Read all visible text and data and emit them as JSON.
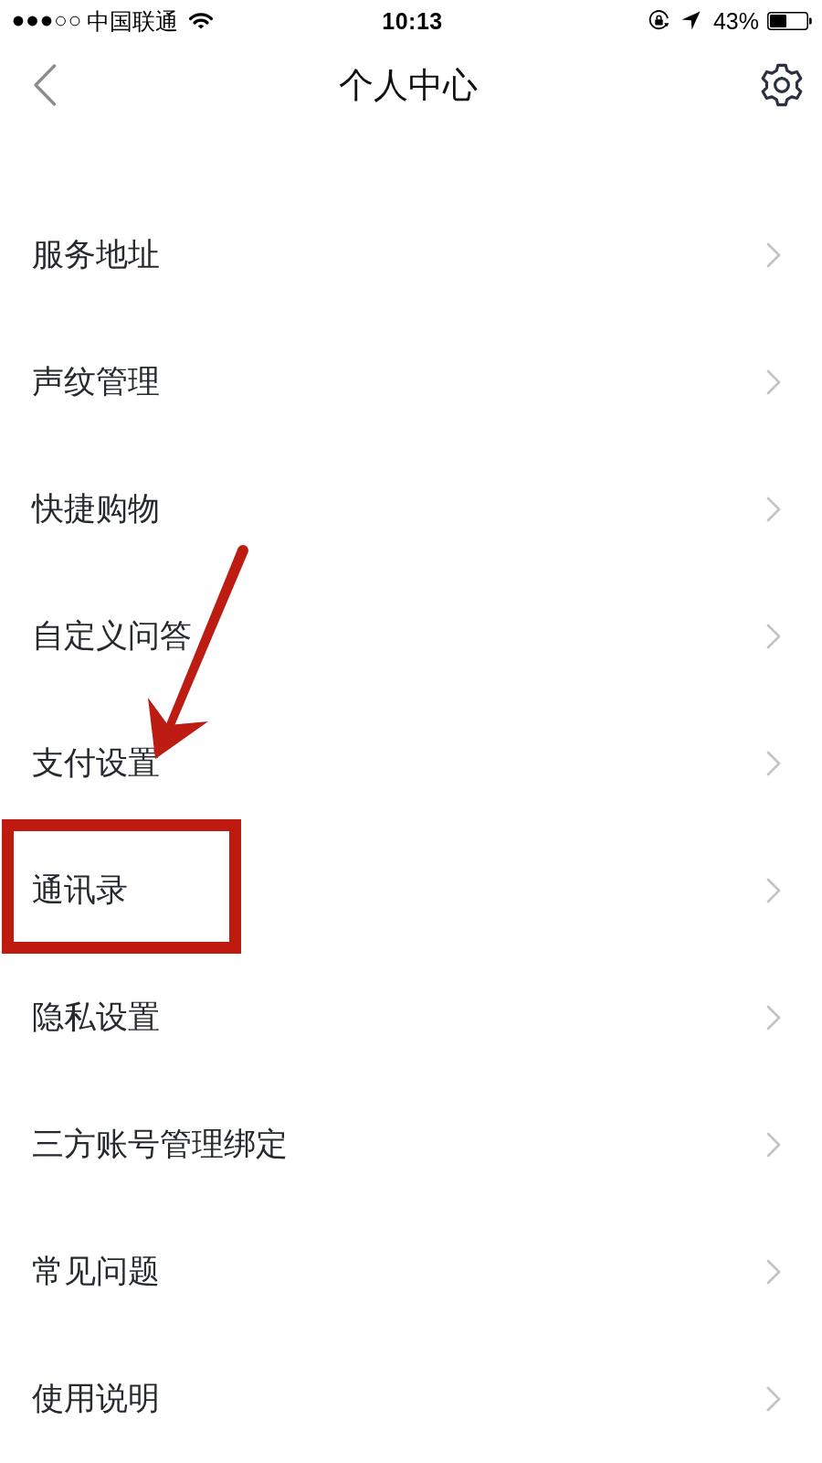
{
  "status_bar": {
    "carrier": "中国联通",
    "time": "10:13",
    "battery": "43%"
  },
  "nav_bar": {
    "title": "个人中心"
  },
  "menu": {
    "items": [
      {
        "label": "服务地址",
        "highlighted": false
      },
      {
        "label": "声纹管理",
        "highlighted": false
      },
      {
        "label": "快捷购物",
        "highlighted": false
      },
      {
        "label": "自定义问答",
        "highlighted": false
      },
      {
        "label": "支付设置",
        "highlighted": false
      },
      {
        "label": "通讯录",
        "highlighted": true
      },
      {
        "label": "隐私设置",
        "highlighted": false
      },
      {
        "label": "三方账号管理绑定",
        "highlighted": false
      },
      {
        "label": "常见问题",
        "highlighted": false
      },
      {
        "label": "使用说明",
        "highlighted": false
      }
    ]
  },
  "annotations": [
    {
      "kind": "arrow"
    }
  ]
}
